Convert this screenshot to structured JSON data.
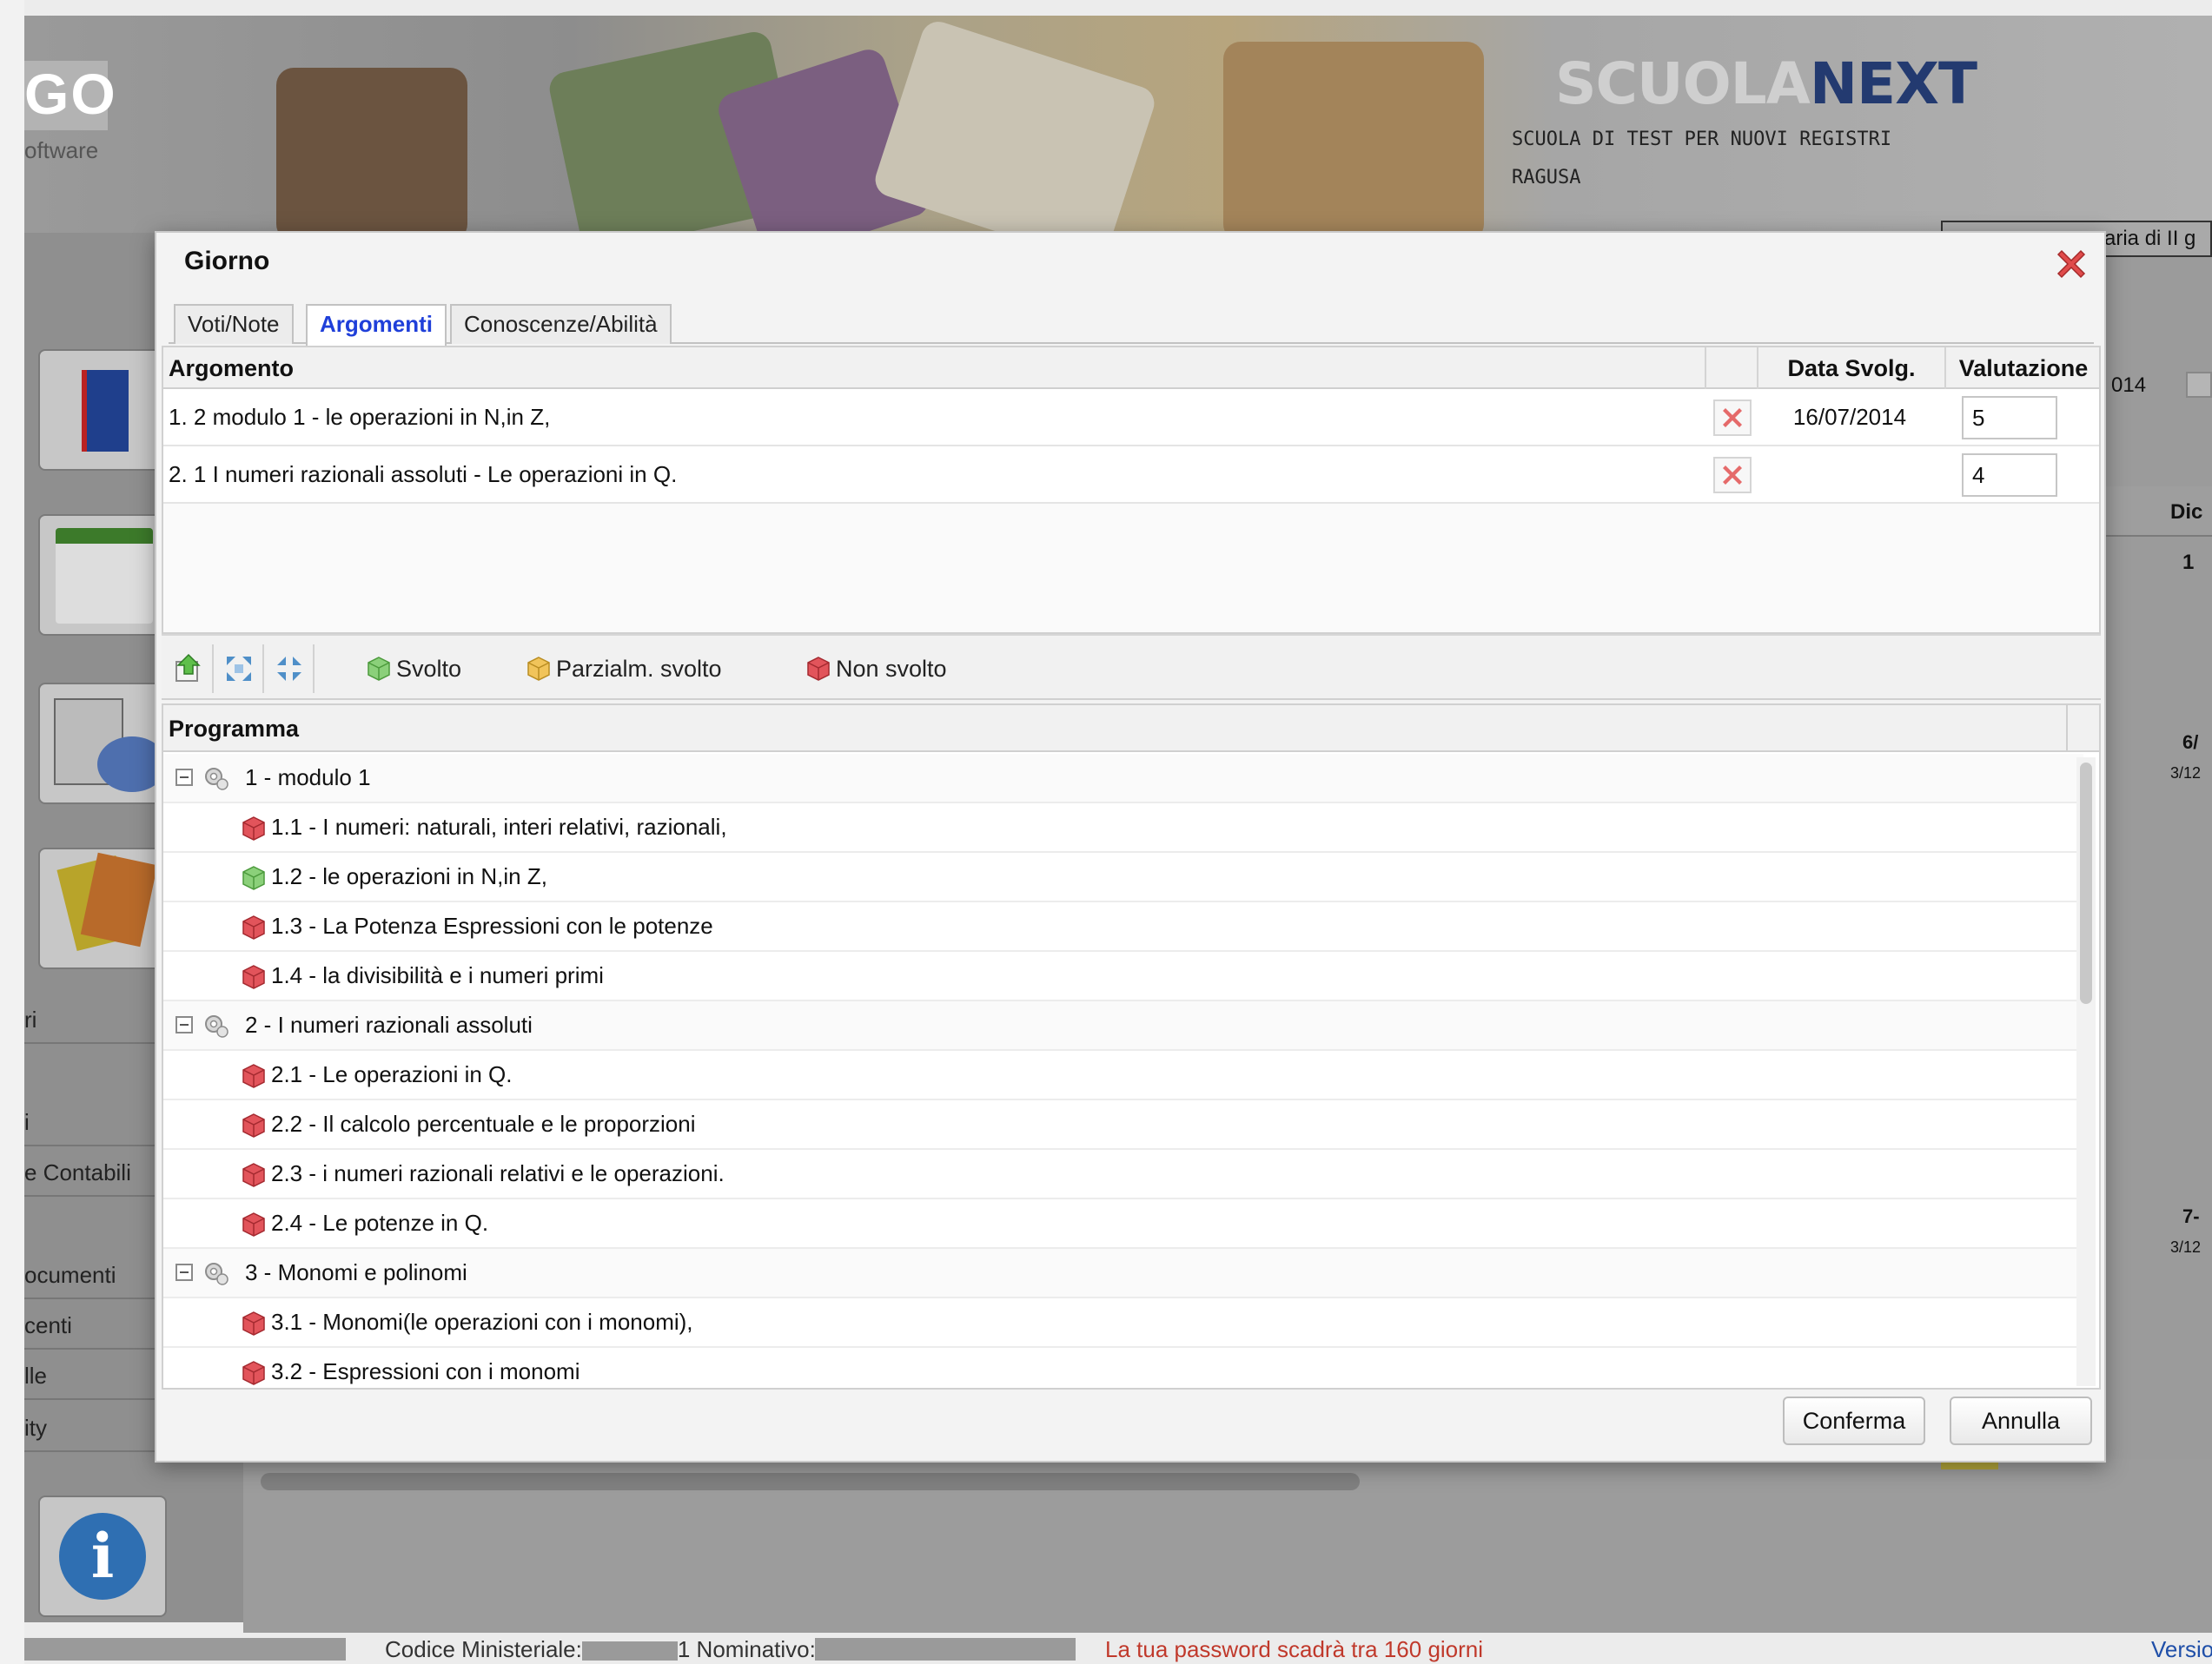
{
  "background": {
    "logo_text": "GO",
    "logo_sub": "oftware",
    "brand_light": "SCUOLA",
    "brand_dark": "NEXT",
    "school_name": "SCUOLA DI TEST PER NUOVI REGISTRI",
    "school_city": "RAGUSA",
    "right_select_text": "aria di II g",
    "right_date": "014",
    "right_month": "Dic",
    "right_day": "1",
    "right_entry1": "6/",
    "right_entry1_sub": "3/12",
    "right_entry2": "7-",
    "right_entry2_sub": "3/12",
    "sidebar_labels": [
      "ri",
      "i",
      "e Contabili",
      "ocumenti",
      "centi",
      "lle",
      "ity"
    ],
    "status_code": "Codice Ministeriale:",
    "status_code_mid": "1 Nominativo:",
    "status_password": "La tua password scadrà tra 160 giorni",
    "status_version": "Versione"
  },
  "dialog": {
    "title": "Giorno",
    "tabs": [
      {
        "label": "Voti/Note",
        "active": false
      },
      {
        "label": "Argomenti",
        "active": true
      },
      {
        "label": "Conoscenze/Abilità",
        "active": false
      }
    ],
    "argomenti": {
      "columns": [
        "Argomento",
        "",
        "Data Svolg.",
        "Valutazione"
      ],
      "rows": [
        {
          "argomento": "1. 2 modulo 1 - le operazioni in N,in Z,",
          "data": "16/07/2014",
          "valutazione": "5"
        },
        {
          "argomento": "2. 1 I numeri razionali assoluti - Le operazioni in Q.",
          "data": "",
          "valutazione": "4"
        }
      ]
    },
    "toolbar": {
      "status_labels": [
        "Svolto",
        "Parzialm. svolto",
        "Non svolto"
      ]
    },
    "programma": {
      "header": "Programma",
      "rows": [
        {
          "type": "group",
          "label": "1 - modulo 1"
        },
        {
          "type": "item",
          "status": "non",
          "label": "1.1 - I numeri: naturali, interi relativi, razionali,"
        },
        {
          "type": "item",
          "status": "svolto",
          "label": "1.2 - le operazioni in N,in Z,"
        },
        {
          "type": "item",
          "status": "non",
          "label": "1.3 - La Potenza Espressioni con le potenze"
        },
        {
          "type": "item",
          "status": "non",
          "label": "1.4 - la divisibilità e i numeri primi"
        },
        {
          "type": "group",
          "label": "2 - I numeri razionali assoluti"
        },
        {
          "type": "item",
          "status": "non",
          "label": "2.1 - Le operazioni in Q."
        },
        {
          "type": "item",
          "status": "non",
          "label": "2.2 - Il calcolo percentuale e le proporzioni"
        },
        {
          "type": "item",
          "status": "non",
          "label": "2.3 - i numeri razionali relativi e le operazioni."
        },
        {
          "type": "item",
          "status": "non",
          "label": "2.4 - Le potenze in Q."
        },
        {
          "type": "group",
          "label": "3 - Monomi e polinomi"
        },
        {
          "type": "item",
          "status": "non",
          "label": "3.1 - Monomi(le operazioni con i monomi),"
        },
        {
          "type": "item",
          "status": "non",
          "label": "3.2 - Espressioni con i monomi"
        }
      ]
    },
    "buttons": {
      "confirm": "Conferma",
      "cancel": "Annulla"
    }
  },
  "colors": {
    "active_tab": "#1f3fd9",
    "svolto": "#8bd07a",
    "parziale": "#f1c45a",
    "non_svolto": "#e2545b",
    "password_warning": "#c0392b",
    "version_link": "#1f4fa8"
  },
  "icons": {
    "close": "close-x-icon",
    "delete": "delete-x-icon",
    "go_up": "go-up-icon",
    "expand_all": "expand-all-icon",
    "collapse_all": "collapse-all-icon",
    "cube": "cube-status-icon",
    "group": "gear-group-icon"
  }
}
